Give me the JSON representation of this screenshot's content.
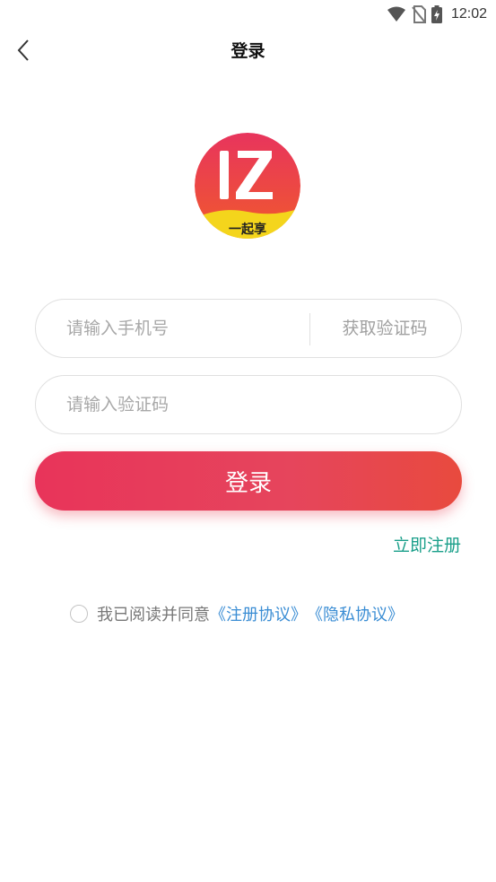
{
  "status_bar": {
    "time": "12:02",
    "icons": [
      "wifi-icon",
      "no-sim-icon",
      "battery-charging-icon"
    ]
  },
  "nav": {
    "back_icon": "chevron-left-icon",
    "title": "登录"
  },
  "logo": {
    "letters": "IZ",
    "tagline": "一起享",
    "colors": {
      "top": "#e83a5f",
      "bottom": "#f4d51c"
    }
  },
  "form": {
    "phone_placeholder": "请输入手机号",
    "phone_value": "",
    "get_code_label": "获取验证码",
    "code_placeholder": "请输入验证码",
    "code_value": "",
    "login_label": "登录",
    "register_label": "立即注册"
  },
  "agreement": {
    "checked": false,
    "prefix": "我已阅读并同意",
    "register_agreement": "《注册协议》",
    "privacy_agreement": "《隐私协议》"
  },
  "colors": {
    "accent": "#e8345a",
    "link_green": "#1a9f8a",
    "link_blue": "#3a8dd4"
  }
}
